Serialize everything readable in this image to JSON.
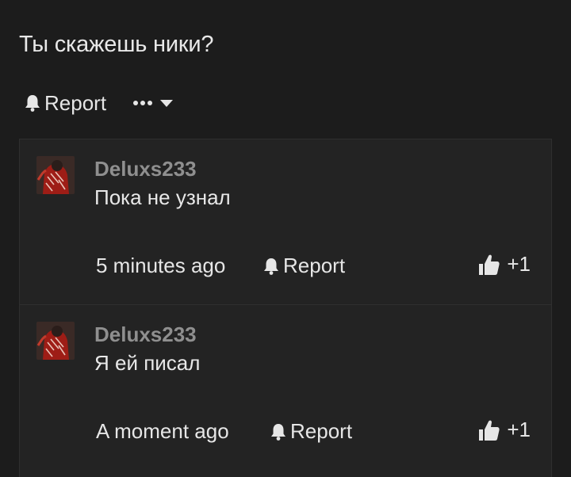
{
  "post": {
    "text": "Ты скажешь ники?",
    "report_label": "Report"
  },
  "comments": [
    {
      "username": "Deluxs233",
      "body": "Пока не узнал",
      "timestamp": "5 minutes ago",
      "report_label": "Report",
      "likes": "+1"
    },
    {
      "username": "Deluxs233",
      "body": "Я ей писал",
      "timestamp": "A moment ago",
      "report_label": "Report",
      "likes": "+1"
    }
  ],
  "icons": {
    "report": "bell-icon",
    "more": "more-dots-icon",
    "dropdown": "chevron-down-icon",
    "like": "thumbs-up-icon",
    "avatar": "user-avatar"
  },
  "colors": {
    "background": "#1c1c1c",
    "comment_background": "#232323",
    "username": "#8f8f8f",
    "text": "#e6e6e6"
  }
}
